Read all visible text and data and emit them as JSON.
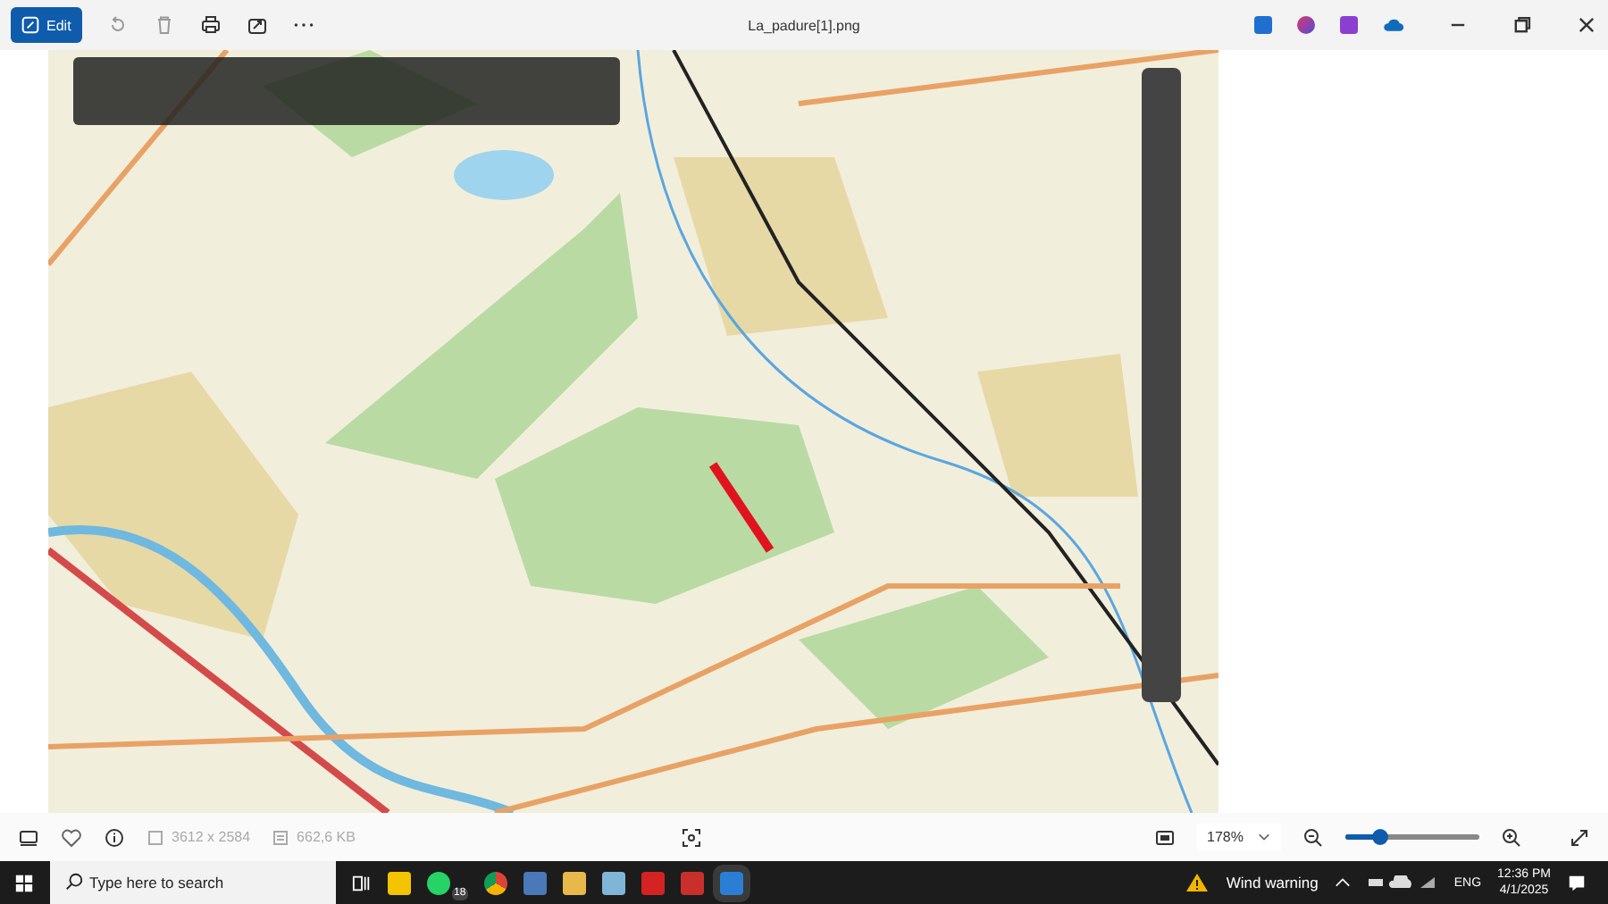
{
  "toolbar": {
    "edit_label": "Edit"
  },
  "window": {
    "title": "La_padure[1].png"
  },
  "info_bar": {
    "dimensions": "3612 x 2584",
    "file_size": "662,6 KB",
    "zoom": "178%",
    "zoom_slider": {
      "level": 0.25
    },
    "favorite": false
  },
  "taskbar": {
    "search_placeholder": "Type here to search",
    "whatsapp_badge": "18",
    "weather": "Wind warning",
    "language": "ENG",
    "time": "12:36 PM",
    "date": "4/1/2025"
  }
}
